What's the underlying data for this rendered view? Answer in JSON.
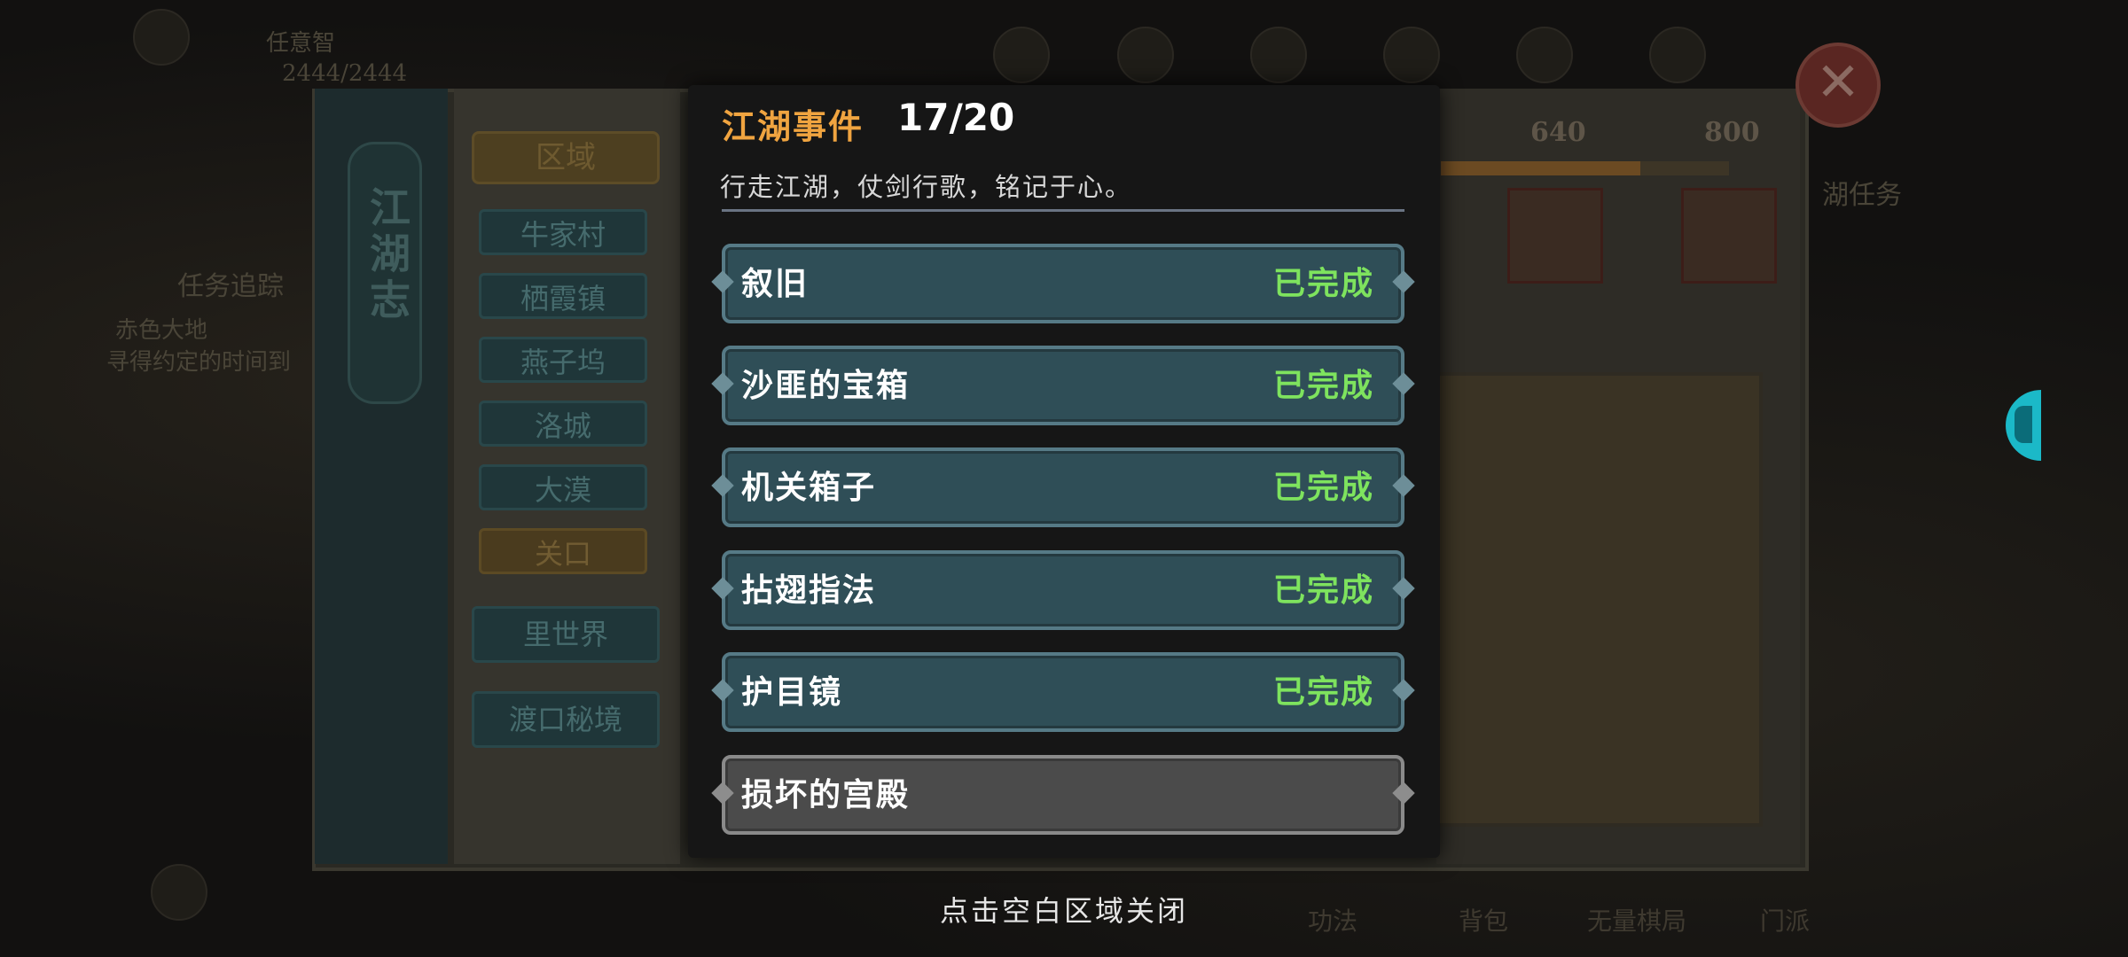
{
  "hud": {
    "player_name": "任意智",
    "hp": "2444/2444"
  },
  "journal": {
    "title": "江湖志",
    "region_header": "区域",
    "regions": [
      "牛家村",
      "栖霞镇",
      "燕子坞",
      "洛城",
      "大漠",
      "关口"
    ],
    "active_region": "关口",
    "extra_tabs": [
      "里世界",
      "渡口秘境"
    ],
    "progress_marks": [
      "640",
      "800"
    ],
    "task_label": "湖任务"
  },
  "side_task": {
    "title": "任务追踪",
    "line1": "赤色大地",
    "line2": "寻得约定的时间到"
  },
  "modal": {
    "title": "江湖事件",
    "count": "17/20",
    "subtitle": "行走江湖，仗剑行歌，铭记于心。",
    "events": [
      {
        "name": "叙旧",
        "status": "已完成"
      },
      {
        "name": "沙匪的宝箱",
        "status": "已完成"
      },
      {
        "name": "机关箱子",
        "status": "已完成"
      },
      {
        "name": "拈翅指法",
        "status": "已完成"
      },
      {
        "name": "护目镜",
        "status": "已完成"
      },
      {
        "name": "损坏的宫殿",
        "status": ""
      }
    ]
  },
  "close_hint": "点击空白区域关闭",
  "bottom_nav": [
    "功法",
    "背包",
    "无量棋局",
    "门派"
  ],
  "colors": {
    "accent_orange": "#f0a440",
    "complete_green": "#7ee35e",
    "row_teal": "#2f4e57",
    "row_locked": "#4b4b4b"
  }
}
